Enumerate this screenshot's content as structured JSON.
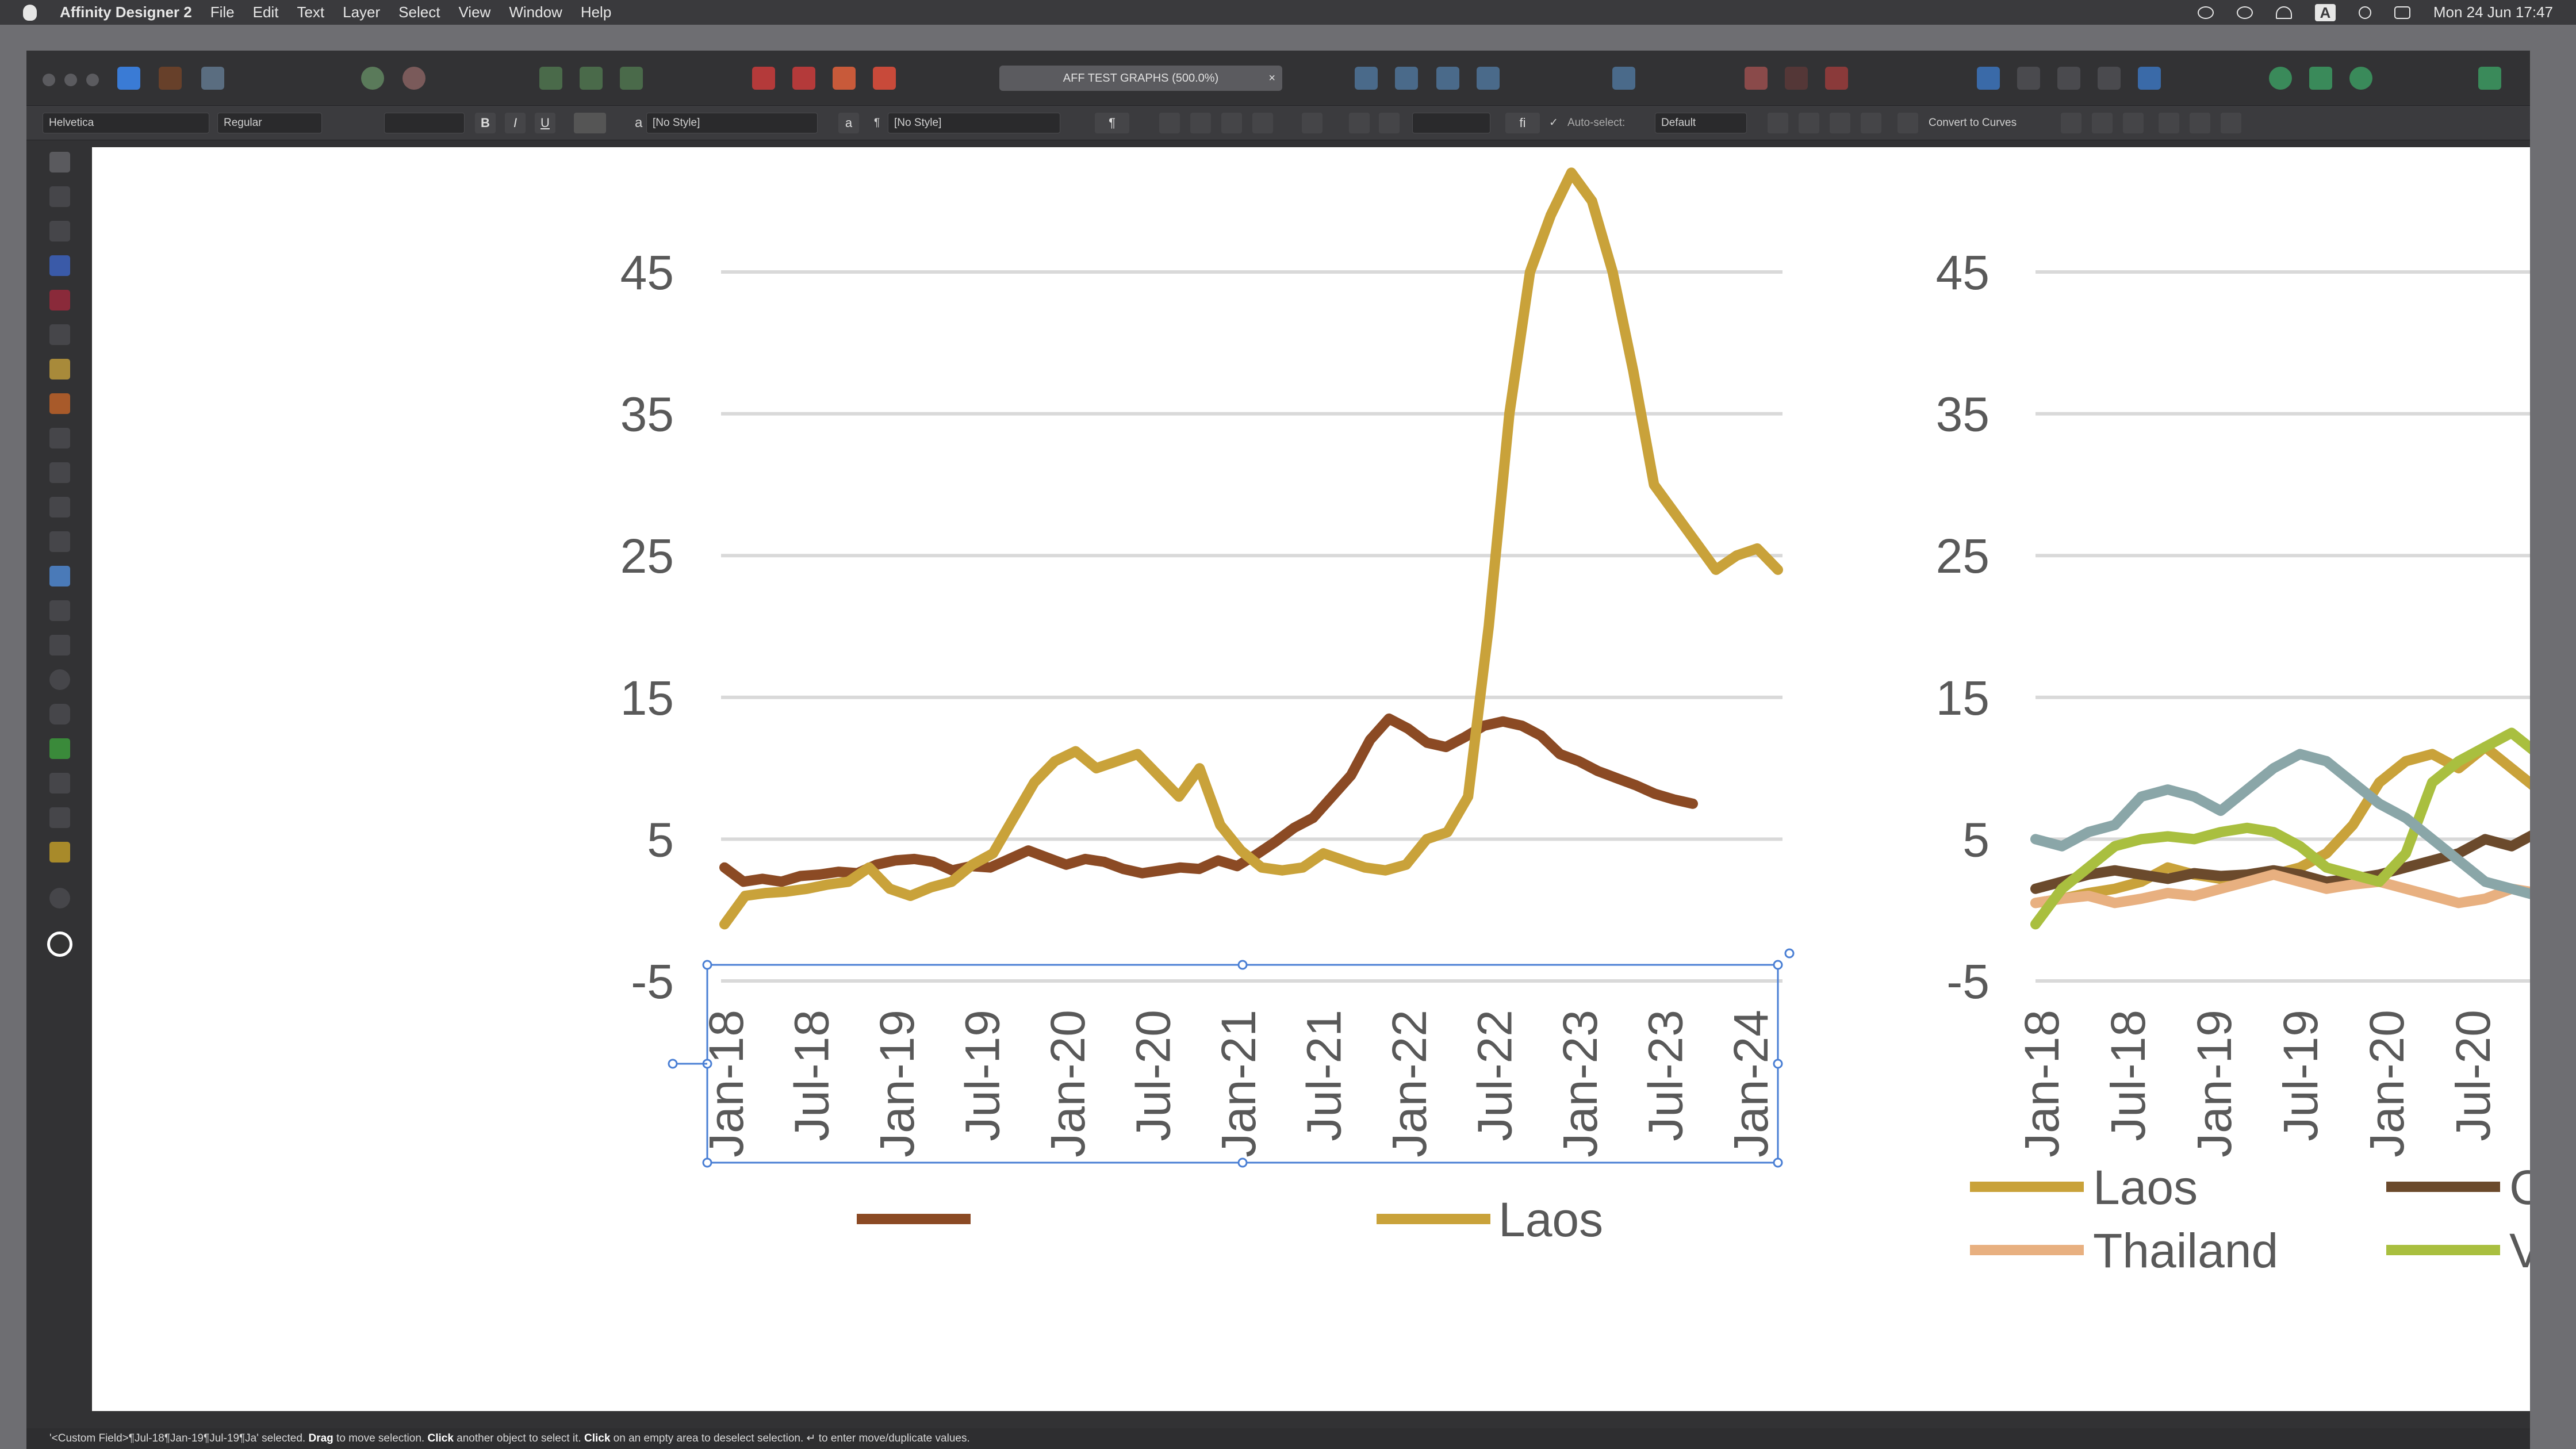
{
  "menubar": {
    "app_name": "Affinity Designer 2",
    "items": [
      "File",
      "Edit",
      "Text",
      "Layer",
      "Select",
      "View",
      "Window",
      "Help"
    ],
    "clock": "Mon 24 Jun  17:47"
  },
  "toolbar": {
    "doc_title": "AFF TEST GRAPHS (500.0%)",
    "close_glyph": "×"
  },
  "context": {
    "font_family": "Helvetica",
    "font_style": "Regular",
    "bold": "B",
    "italic": "I",
    "underline": "U",
    "char_style_icon": "a",
    "char_style": "[No Style]",
    "para_style_icon": "¶",
    "para_style": "[No Style]",
    "ligature": "fi",
    "autoselect_label": "Auto-select:",
    "autoselect_value": "Default",
    "convert_label": "Convert to Curves"
  },
  "status": {
    "selected_text": "'<Custom Field>¶Jul-18¶Jan-19¶Jul-19¶Ja' selected.",
    "drag": "Drag",
    "drag_hint": "to move selection.",
    "click": "Click",
    "click_hint": "another object to select it.",
    "click2": "Click",
    "click2_hint": "on an empty area to deselect selection.",
    "enter_hint": "↵ to enter move/duplicate values."
  },
  "colors": {
    "laos": "#c9a23a",
    "cambodia": "#8b4a24",
    "series2_cambodia": "#6b4a2c",
    "thailand": "#e8b080",
    "vietnam": "#a9bf3f",
    "blue_grey": "#8aa6a8",
    "selection": "#4a7fd4"
  },
  "chart_data": [
    {
      "type": "line",
      "yticks": [
        45,
        35,
        25,
        15,
        5,
        -5
      ],
      "ylim": [
        -5,
        49
      ],
      "x": [
        "Jan-18",
        "Jul-18",
        "Jan-19",
        "Jul-19",
        "Jan-20",
        "Jul-20",
        "Jan-21",
        "Jul-21",
        "Jan-22",
        "Jul-22",
        "Jan-23",
        "Jul-23",
        "Jan-24"
      ],
      "series": [
        {
          "name": "",
          "color_key": "cambodia",
          "values": [
            3,
            2,
            2.2,
            2,
            2.4,
            2.5,
            2.7,
            2.6,
            3.2,
            3.5,
            3.6,
            3.4,
            2.8,
            3.1,
            3.0,
            3.6,
            4.2,
            3.7,
            3.2,
            3.6,
            3.4,
            2.9,
            2.6,
            2.8,
            3.0,
            2.9,
            3.5,
            3.1,
            3.9,
            4.8,
            5.8,
            6.5,
            8.0,
            9.5,
            12.0,
            13.5,
            12.8,
            11.8,
            11.5,
            12.2,
            13.0,
            13.3,
            13.0,
            12.3,
            11.0,
            10.5,
            9.8,
            9.3,
            8.8,
            8.2,
            7.8,
            7.5
          ]
        },
        {
          "name": "Laos",
          "color_key": "laos",
          "values": [
            -1,
            1,
            1.2,
            1.3,
            1.5,
            1.8,
            2.0,
            3.0,
            1.5,
            1.0,
            1.6,
            2.0,
            3.2,
            4.0,
            6.5,
            9.0,
            10.5,
            11.2,
            10.0,
            10.5,
            11.0,
            9.5,
            8.0,
            10.0,
            6.0,
            4.2,
            3.0,
            2.8,
            3.0,
            4.0,
            3.5,
            3.0,
            2.8,
            3.2,
            5.0,
            5.5,
            8.0,
            20.0,
            35.0,
            45.0,
            49.0,
            52.0,
            50.0,
            45.0,
            38.0,
            30.0,
            28.0,
            26.0,
            24.0,
            25.0,
            25.5,
            24.0
          ]
        }
      ]
    },
    {
      "type": "line",
      "yticks": [
        45,
        35,
        25,
        15,
        5,
        -5
      ],
      "ylim": [
        -5,
        49
      ],
      "x": [
        "Jan-18",
        "Jul-18",
        "Jan-19",
        "Jul-19",
        "Jan-20",
        "Jul-20"
      ],
      "legend": [
        "Laos",
        "Ca",
        "Thailand",
        "Vi"
      ],
      "series": [
        {
          "name": "Laos",
          "color_key": "laos",
          "values": [
            0.5,
            0.8,
            1.2,
            1.5,
            2.0,
            3.0,
            2.5,
            2.2,
            2.0,
            2.5,
            3.0,
            4.0,
            6.0,
            9.0,
            10.5,
            11.0,
            10.0,
            11.5,
            10.0,
            8.5,
            6.0
          ]
        },
        {
          "name": "Ca",
          "color_key": "series2_cambodia",
          "values": [
            1.5,
            2.0,
            2.5,
            2.8,
            2.5,
            2.2,
            2.6,
            2.4,
            2.5,
            2.8,
            2.5,
            2.0,
            2.2,
            2.5,
            3.0,
            3.5,
            4.0,
            5.0,
            4.5,
            5.5,
            5.0
          ]
        },
        {
          "name": "Thailand",
          "color_key": "thailand",
          "values": [
            0.5,
            0.8,
            1.0,
            0.5,
            0.8,
            1.2,
            1.0,
            1.5,
            2.0,
            2.5,
            2.0,
            1.5,
            1.8,
            2.0,
            1.5,
            1.0,
            0.5,
            0.8,
            1.5,
            1.2,
            1.0
          ]
        },
        {
          "name": "Vi",
          "color_key": "vietnam",
          "values": [
            -1,
            1.5,
            3.0,
            4.5,
            5.0,
            5.2,
            5.0,
            5.5,
            5.8,
            5.5,
            4.5,
            3.0,
            2.5,
            2.0,
            4.0,
            9.0,
            10.5,
            11.5,
            12.5,
            11.0,
            6.0
          ]
        },
        {
          "name": "",
          "color_key": "blue_grey",
          "values": [
            5,
            4.5,
            5.5,
            6.0,
            8.0,
            8.5,
            8.0,
            7.0,
            8.5,
            10.0,
            11.0,
            10.5,
            9.0,
            7.5,
            6.5,
            5.0,
            3.5,
            2.0,
            1.5,
            1.0,
            0.8
          ]
        }
      ]
    }
  ]
}
